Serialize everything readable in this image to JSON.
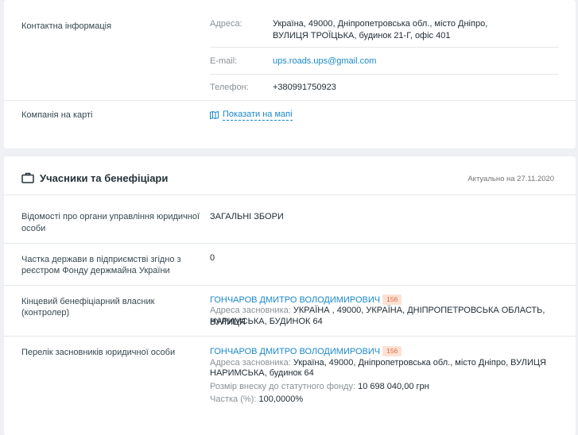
{
  "contacts": {
    "section_label": "Контактна інформація",
    "address_label": "Адреса:",
    "address_line1": "Україна, 49000, Дніпропетровська обл., місто Дніпро,",
    "address_line2": "ВУЛИЦЯ ТРОЇЦЬКА, будинок 21-Г, офіс 401",
    "email_label": "E-mail:",
    "email_value": "ups.roads.ups@gmail.com",
    "phone_label": "Телефон:",
    "phone_value": "+380991750923",
    "map_label": "Компанія на карті",
    "map_link": "Показати на мапі",
    "map_icon": "map-icon"
  },
  "participants": {
    "title": "Учасники та бенефіціари",
    "title_icon": "briefcase-icon",
    "actual_date": "Актуально на 27.11.2020",
    "governance_label_1": "Відомості про органи управління юридичної",
    "governance_label_2": "особи",
    "governance_value": "ЗАГАЛЬНІ ЗБОРИ",
    "state_share_label_1": "Частка держави в підприємстві згідно з",
    "state_share_label_2": "реєстром Фонду держмайна України",
    "state_share_value": "0",
    "beneficiary_label_1": "Кінцевий бенефіціарний власник",
    "beneficiary_label_2": "(контролер)",
    "beneficiary_name": "ГОНЧАРОВ ДМИТРО ВОЛОДИМИРОВИЧ",
    "beneficiary_badge": "156",
    "beneficiary_addr_label": "Адреса засновника:",
    "beneficiary_addr_1": "УКРАЇНА , 49000, УКРАЇНА, ДНІПРОПЕТРОВСЬКА ОБЛАСТЬ, ВУЛИЦЯ",
    "beneficiary_addr_2": "НАРИМСЬКА, БУДИНОК 64",
    "founders_label": "Перелік засновників юридичної особи",
    "founder_name": "ГОНЧАРОВ ДМИТРО ВОЛОДИМИРОВИЧ",
    "founder_badge": "156",
    "founder_addr_label": "Адреса засновника:",
    "founder_addr_1": "Україна, 49000, Дніпропетровська обл., місто Дніпро, ВУЛИЦЯ",
    "founder_addr_2": "НАРИМСЬКА, будинок 64",
    "capital_label": "Розмір внеску до статутного фонду:",
    "capital_value": "10 698 040,00 грн",
    "share_label": "Частка (%):",
    "share_value": "100,0000%"
  },
  "colors": {
    "accent": "#1b88c9",
    "badge_bg": "#fde2d4",
    "badge_text": "#d8693b"
  }
}
